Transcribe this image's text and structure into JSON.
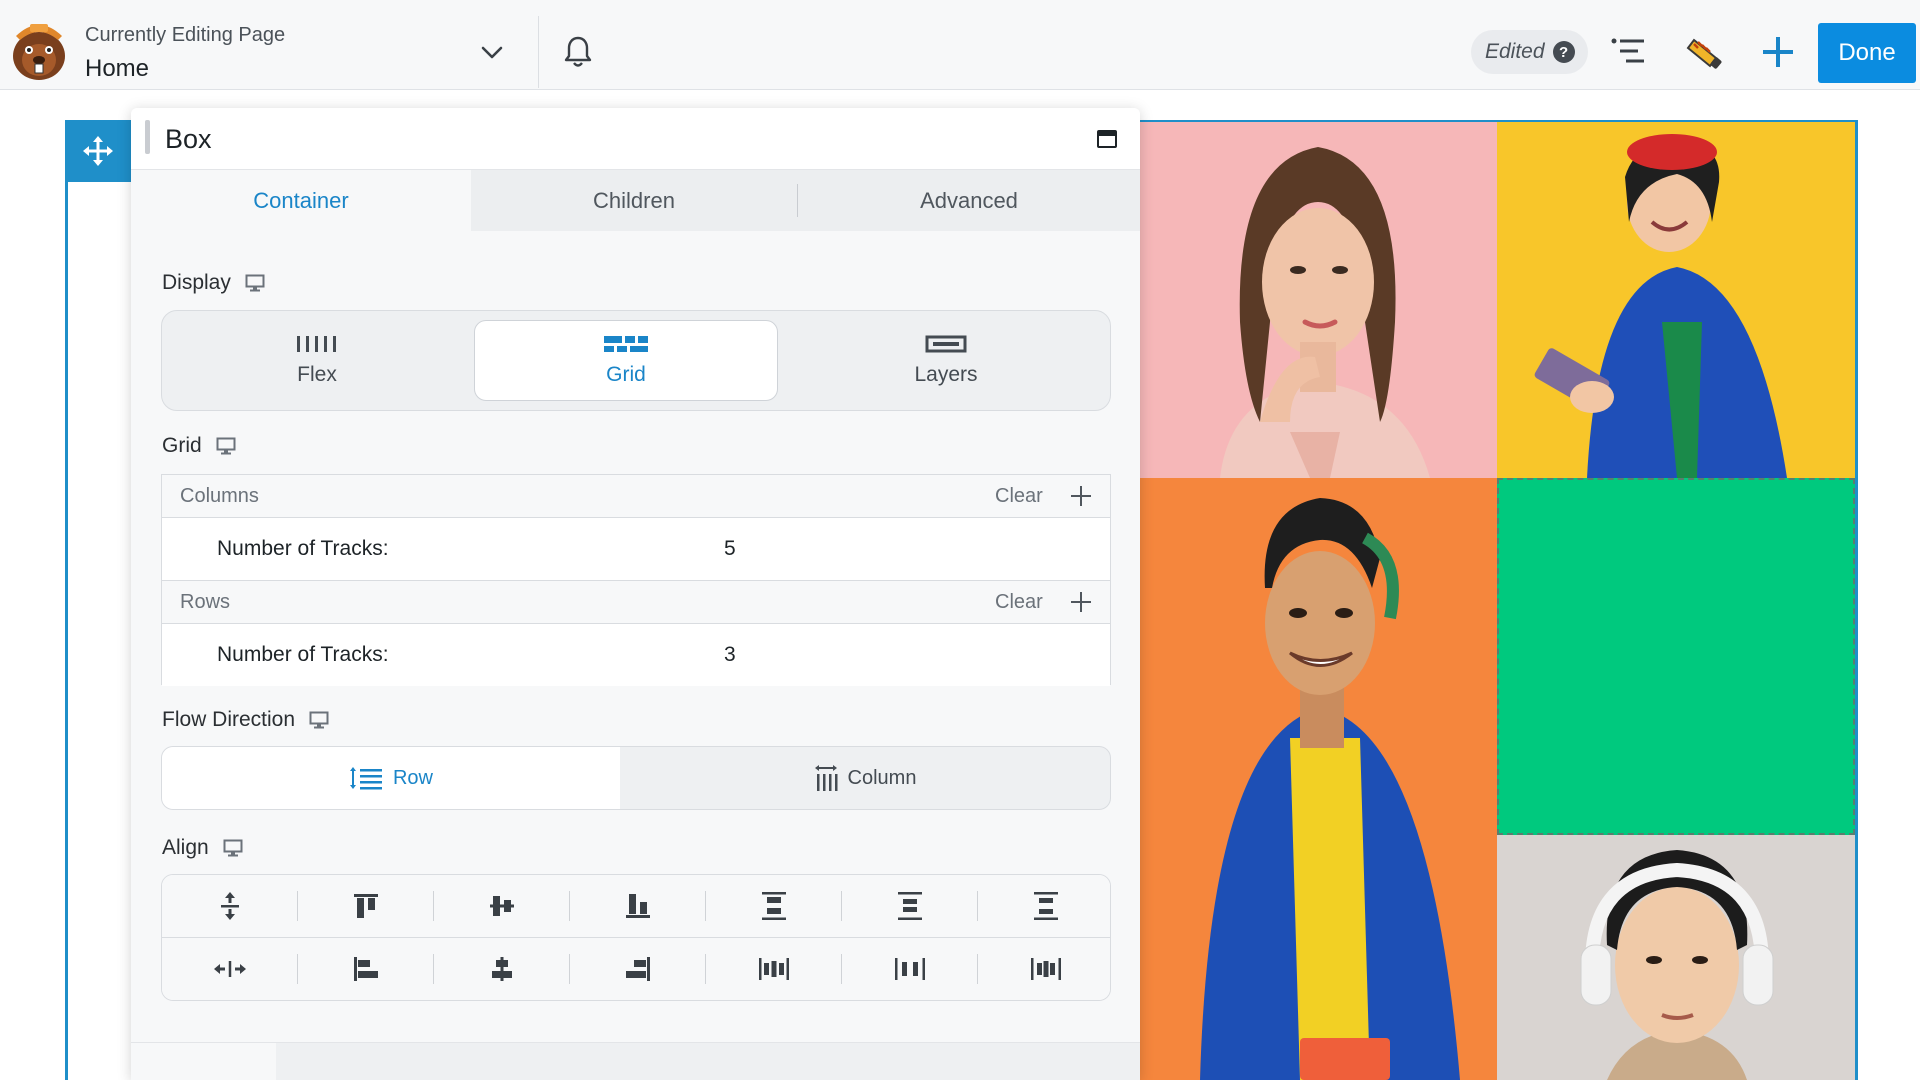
{
  "topbar": {
    "editing_label": "Currently Editing Page",
    "page_name": "Home",
    "edited_label": "Edited",
    "help_glyph": "?",
    "done_label": "Done",
    "accent": "#0b8ce0"
  },
  "panel": {
    "title": "Box",
    "tabs": [
      {
        "label": "Container",
        "active": true
      },
      {
        "label": "Children",
        "active": false
      },
      {
        "label": "Advanced",
        "active": false
      }
    ],
    "display": {
      "label": "Display",
      "options": [
        {
          "label": "Flex",
          "icon": "flex-icon"
        },
        {
          "label": "Grid",
          "icon": "grid-icon",
          "selected": true
        },
        {
          "label": "Layers",
          "icon": "layers-icon"
        }
      ]
    },
    "grid": {
      "label": "Grid",
      "columns": {
        "label": "Columns",
        "clear": "Clear",
        "tracks_label": "Number of Tracks:",
        "tracks": "5"
      },
      "rows": {
        "label": "Rows",
        "clear": "Clear",
        "tracks_label": "Number of Tracks:",
        "tracks": "3"
      }
    },
    "flow": {
      "label": "Flow Direction",
      "options": [
        {
          "label": "Row",
          "selected": true
        },
        {
          "label": "Column"
        }
      ]
    },
    "align": {
      "label": "Align",
      "row1_icons": [
        "align-stretch-vertical-icon",
        "align-top-icon",
        "align-middle-icon",
        "align-bottom-icon",
        "space-between-vertical-icon",
        "space-around-vertical-icon",
        "space-evenly-vertical-icon"
      ],
      "row2_icons": [
        "align-stretch-horizontal-icon",
        "align-left-icon",
        "align-center-icon",
        "align-right-icon",
        "space-between-horizontal-icon",
        "space-around-horizontal-icon",
        "space-evenly-horizontal-icon"
      ]
    }
  },
  "canvas": {
    "frame_color": "#1f8fc9",
    "cells": [
      {
        "name": "photo-woman-pink",
        "bg": "#f6b7b8"
      },
      {
        "name": "photo-woman-yellow",
        "bg": "#f8c62a"
      },
      {
        "name": "photo-man-orange",
        "bg": "#f5863d"
      },
      {
        "name": "empty-green-cell",
        "bg": "#00c97e"
      },
      {
        "name": "photo-man-headphones",
        "bg": "#d9d4d1"
      }
    ]
  }
}
